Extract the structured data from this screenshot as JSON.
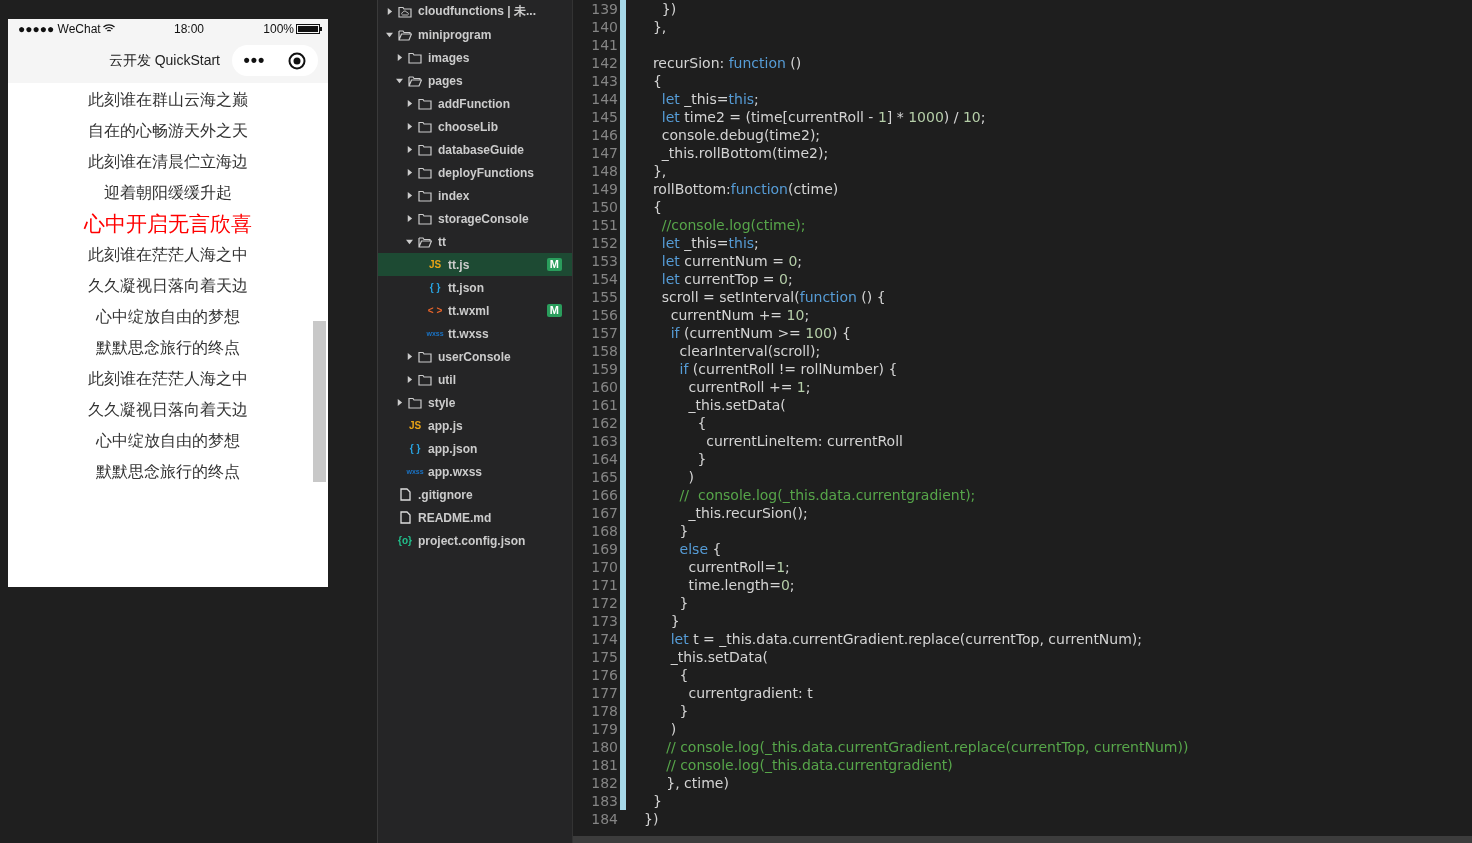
{
  "simulator": {
    "status_bar": {
      "carrier": "●●●●● WeChat",
      "time": "18:00",
      "battery": "100%"
    },
    "nav_bar": {
      "title": "云开发 QuickStart",
      "menu": "•••"
    },
    "lyrics": [
      {
        "text": "此刻谁在群山云海之巅",
        "selected": false
      },
      {
        "text": "自在的心畅游天外之天",
        "selected": false
      },
      {
        "text": "此刻谁在清晨伫立海边",
        "selected": false
      },
      {
        "text": "迎着朝阳缓缓升起",
        "selected": false
      },
      {
        "text": "心中开启无言欣喜",
        "selected": true
      },
      {
        "text": "此刻谁在茫茫人海之中",
        "selected": false
      },
      {
        "text": "久久凝视日落向着天边",
        "selected": false
      },
      {
        "text": "心中绽放自由的梦想",
        "selected": false
      },
      {
        "text": "默默思念旅行的终点",
        "selected": false
      },
      {
        "text": "此刻谁在茫茫人海之中",
        "selected": false
      },
      {
        "text": "久久凝视日落向着天边",
        "selected": false
      },
      {
        "text": "心中绽放自由的梦想",
        "selected": false
      },
      {
        "text": "默默思念旅行的终点",
        "selected": false
      }
    ]
  },
  "file_tree": [
    {
      "label": "cloudfunctions | 未...",
      "kind": "cloud-folder",
      "expanded": false,
      "selected": false
    },
    {
      "label": "miniprogram",
      "kind": "folder",
      "expanded": true,
      "selected": false,
      "children": [
        {
          "label": "images",
          "kind": "folder",
          "expanded": false,
          "selected": false
        },
        {
          "label": "pages",
          "kind": "folder",
          "expanded": true,
          "selected": false,
          "children": [
            {
              "label": "addFunction",
              "kind": "folder",
              "expanded": false,
              "selected": false
            },
            {
              "label": "chooseLib",
              "kind": "folder",
              "expanded": false,
              "selected": false
            },
            {
              "label": "databaseGuide",
              "kind": "folder",
              "expanded": false,
              "selected": false
            },
            {
              "label": "deployFunctions",
              "kind": "folder",
              "expanded": false,
              "selected": false
            },
            {
              "label": "index",
              "kind": "folder",
              "expanded": false,
              "selected": false
            },
            {
              "label": "storageConsole",
              "kind": "folder",
              "expanded": false,
              "selected": false
            },
            {
              "label": "tt",
              "kind": "folder",
              "expanded": true,
              "selected": false,
              "children": [
                {
                  "label": "tt.js",
                  "kind": "js",
                  "icon": "JS",
                  "selected": true,
                  "badge": "M"
                },
                {
                  "label": "tt.json",
                  "kind": "json",
                  "icon": "{ }",
                  "selected": false
                },
                {
                  "label": "tt.wxml",
                  "kind": "wxml",
                  "icon": "< >",
                  "selected": false,
                  "badge": "M"
                },
                {
                  "label": "tt.wxss",
                  "kind": "wxss",
                  "icon": "wxss",
                  "selected": false
                }
              ]
            },
            {
              "label": "userConsole",
              "kind": "folder",
              "expanded": false,
              "selected": false
            },
            {
              "label": "util",
              "kind": "folder",
              "expanded": false,
              "selected": false
            }
          ]
        },
        {
          "label": "style",
          "kind": "folder",
          "expanded": false,
          "selected": false
        },
        {
          "label": "app.js",
          "kind": "js",
          "icon": "JS",
          "selected": false
        },
        {
          "label": "app.json",
          "kind": "json",
          "icon": "{ }",
          "selected": false
        },
        {
          "label": "app.wxss",
          "kind": "wxss",
          "icon": "wxss",
          "selected": false
        }
      ]
    },
    {
      "label": ".gitignore",
      "kind": "file",
      "selected": false
    },
    {
      "label": "README.md",
      "kind": "file",
      "selected": false
    },
    {
      "label": "project.config.json",
      "kind": "config",
      "icon": "{o}",
      "selected": false
    }
  ],
  "editor": {
    "lines": [
      {
        "number": "139",
        "modified": true,
        "tokens": [
          {
            "kind": "plain",
            "text": "    })"
          }
        ]
      },
      {
        "number": "140",
        "modified": true,
        "tokens": [
          {
            "kind": "plain",
            "text": "  },"
          }
        ]
      },
      {
        "number": "141",
        "modified": true
      },
      {
        "number": "142",
        "modified": true,
        "tokens": [
          {
            "kind": "plain",
            "text": "  recurSion: "
          },
          {
            "kind": "kw",
            "text": "function"
          },
          {
            "kind": "plain",
            "text": " ()"
          }
        ]
      },
      {
        "number": "143",
        "modified": true,
        "tokens": [
          {
            "kind": "plain",
            "text": "  {"
          }
        ]
      },
      {
        "number": "144",
        "modified": true,
        "tokens": [
          {
            "kind": "kw",
            "text": "    let"
          },
          {
            "kind": "plain",
            "text": " _this="
          },
          {
            "kind": "kw",
            "text": "this"
          },
          {
            "kind": "plain",
            "text": ";"
          }
        ]
      },
      {
        "number": "145",
        "modified": true,
        "tokens": [
          {
            "kind": "kw",
            "text": "    let"
          },
          {
            "kind": "plain",
            "text": " time2 = (time[currentRoll - "
          },
          {
            "kind": "num",
            "text": "1"
          },
          {
            "kind": "plain",
            "text": "] * "
          },
          {
            "kind": "num",
            "text": "1000"
          },
          {
            "kind": "plain",
            "text": ") / "
          },
          {
            "kind": "num",
            "text": "10"
          },
          {
            "kind": "plain",
            "text": ";"
          }
        ]
      },
      {
        "number": "146",
        "modified": true,
        "tokens": [
          {
            "kind": "plain",
            "text": "    console.debug(time2);"
          }
        ]
      },
      {
        "number": "147",
        "modified": true,
        "tokens": [
          {
            "kind": "plain",
            "text": "    _this.rollBottom(time2);"
          }
        ]
      },
      {
        "number": "148",
        "modified": true,
        "tokens": [
          {
            "kind": "plain",
            "text": "  },"
          }
        ]
      },
      {
        "number": "149",
        "modified": true,
        "tokens": [
          {
            "kind": "plain",
            "text": "  rollBottom:"
          },
          {
            "kind": "kw",
            "text": "function"
          },
          {
            "kind": "plain",
            "text": "(ctime)"
          }
        ]
      },
      {
        "number": "150",
        "modified": true,
        "tokens": [
          {
            "kind": "plain",
            "text": "  {"
          }
        ]
      },
      {
        "number": "151",
        "modified": true,
        "tokens": [
          {
            "kind": "comment",
            "text": "    //console.log(ctime);"
          }
        ]
      },
      {
        "number": "152",
        "modified": true,
        "tokens": [
          {
            "kind": "kw",
            "text": "    let"
          },
          {
            "kind": "plain",
            "text": " _this="
          },
          {
            "kind": "kw",
            "text": "this"
          },
          {
            "kind": "plain",
            "text": ";"
          }
        ]
      },
      {
        "number": "153",
        "modified": true,
        "tokens": [
          {
            "kind": "kw",
            "text": "    let"
          },
          {
            "kind": "plain",
            "text": " currentNum = "
          },
          {
            "kind": "num",
            "text": "0"
          },
          {
            "kind": "plain",
            "text": ";"
          }
        ]
      },
      {
        "number": "154",
        "modified": true,
        "tokens": [
          {
            "kind": "kw",
            "text": "    let"
          },
          {
            "kind": "plain",
            "text": " currentTop = "
          },
          {
            "kind": "num",
            "text": "0"
          },
          {
            "kind": "plain",
            "text": ";"
          }
        ]
      },
      {
        "number": "155",
        "modified": true,
        "tokens": [
          {
            "kind": "plain",
            "text": "    scroll = setInterval("
          },
          {
            "kind": "kw",
            "text": "function"
          },
          {
            "kind": "plain",
            "text": " () {"
          }
        ]
      },
      {
        "number": "156",
        "modified": true,
        "tokens": [
          {
            "kind": "plain",
            "text": "      currentNum += "
          },
          {
            "kind": "num",
            "text": "10"
          },
          {
            "kind": "plain",
            "text": ";"
          }
        ]
      },
      {
        "number": "157",
        "modified": true,
        "tokens": [
          {
            "kind": "kw",
            "text": "      if"
          },
          {
            "kind": "plain",
            "text": " (currentNum >= "
          },
          {
            "kind": "num",
            "text": "100"
          },
          {
            "kind": "plain",
            "text": ") {"
          }
        ]
      },
      {
        "number": "158",
        "modified": true,
        "tokens": [
          {
            "kind": "plain",
            "text": "        clearInterval(scroll);"
          }
        ]
      },
      {
        "number": "159",
        "modified": true,
        "tokens": [
          {
            "kind": "kw",
            "text": "        if"
          },
          {
            "kind": "plain",
            "text": " (currentRoll != rollNumber) {"
          }
        ]
      },
      {
        "number": "160",
        "modified": true,
        "tokens": [
          {
            "kind": "plain",
            "text": "          currentRoll += "
          },
          {
            "kind": "num",
            "text": "1"
          },
          {
            "kind": "plain",
            "text": ";"
          }
        ]
      },
      {
        "number": "161",
        "modified": true,
        "tokens": [
          {
            "kind": "plain",
            "text": "          _this.setData("
          }
        ]
      },
      {
        "number": "162",
        "modified": true,
        "tokens": [
          {
            "kind": "plain",
            "text": "            {"
          }
        ]
      },
      {
        "number": "163",
        "modified": true,
        "tokens": [
          {
            "kind": "plain",
            "text": "              currentLineItem: currentRoll"
          }
        ]
      },
      {
        "number": "164",
        "modified": true,
        "tokens": [
          {
            "kind": "plain",
            "text": "            }"
          }
        ]
      },
      {
        "number": "165",
        "modified": true,
        "tokens": [
          {
            "kind": "plain",
            "text": "          )"
          }
        ]
      },
      {
        "number": "166",
        "modified": true,
        "tokens": [
          {
            "kind": "comment",
            "text": "        //  console.log(_this.data.currentgradient);"
          }
        ]
      },
      {
        "number": "167",
        "modified": true,
        "tokens": [
          {
            "kind": "plain",
            "text": "          _this.recurSion();"
          }
        ]
      },
      {
        "number": "168",
        "modified": true,
        "tokens": [
          {
            "kind": "plain",
            "text": "        }"
          }
        ]
      },
      {
        "number": "169",
        "modified": true,
        "tokens": [
          {
            "kind": "kw",
            "text": "        else"
          },
          {
            "kind": "plain",
            "text": " {"
          }
        ]
      },
      {
        "number": "170",
        "modified": true,
        "tokens": [
          {
            "kind": "plain",
            "text": "          currentRoll="
          },
          {
            "kind": "num",
            "text": "1"
          },
          {
            "kind": "plain",
            "text": ";"
          }
        ]
      },
      {
        "number": "171",
        "modified": true,
        "tokens": [
          {
            "kind": "plain",
            "text": "          time.length="
          },
          {
            "kind": "num",
            "text": "0"
          },
          {
            "kind": "plain",
            "text": ";"
          }
        ]
      },
      {
        "number": "172",
        "modified": true,
        "tokens": [
          {
            "kind": "plain",
            "text": "        }"
          }
        ]
      },
      {
        "number": "173",
        "modified": true,
        "tokens": [
          {
            "kind": "plain",
            "text": "      }"
          }
        ]
      },
      {
        "number": "174",
        "modified": true,
        "tokens": [
          {
            "kind": "kw",
            "text": "      let"
          },
          {
            "kind": "plain",
            "text": " t = _this.data.currentGradient.replace(currentTop, currentNum);"
          }
        ]
      },
      {
        "number": "175",
        "modified": true,
        "tokens": [
          {
            "kind": "plain",
            "text": "      _this.setData("
          }
        ]
      },
      {
        "number": "176",
        "modified": true,
        "tokens": [
          {
            "kind": "plain",
            "text": "        {"
          }
        ]
      },
      {
        "number": "177",
        "modified": true,
        "tokens": [
          {
            "kind": "plain",
            "text": "          currentgradient: t"
          }
        ]
      },
      {
        "number": "178",
        "modified": true,
        "tokens": [
          {
            "kind": "plain",
            "text": "        }"
          }
        ]
      },
      {
        "number": "179",
        "modified": true,
        "tokens": [
          {
            "kind": "plain",
            "text": "      )"
          }
        ]
      },
      {
        "number": "180",
        "modified": true,
        "tokens": [
          {
            "kind": "comment",
            "text": "     // console.log(_this.data.currentGradient.replace(currentTop, currentNum))"
          }
        ]
      },
      {
        "number": "181",
        "modified": true,
        "tokens": [
          {
            "kind": "comment",
            "text": "     // console.log(_this.data.currentgradient)"
          }
        ]
      },
      {
        "number": "182",
        "modified": true,
        "tokens": [
          {
            "kind": "plain",
            "text": "     }, ctime)"
          }
        ]
      },
      {
        "number": "183",
        "modified": true,
        "tokens": [
          {
            "kind": "plain",
            "text": "  }"
          }
        ]
      },
      {
        "number": "184",
        "modified": false,
        "tokens": [
          {
            "kind": "plain",
            "text": "})"
          }
        ]
      }
    ]
  }
}
